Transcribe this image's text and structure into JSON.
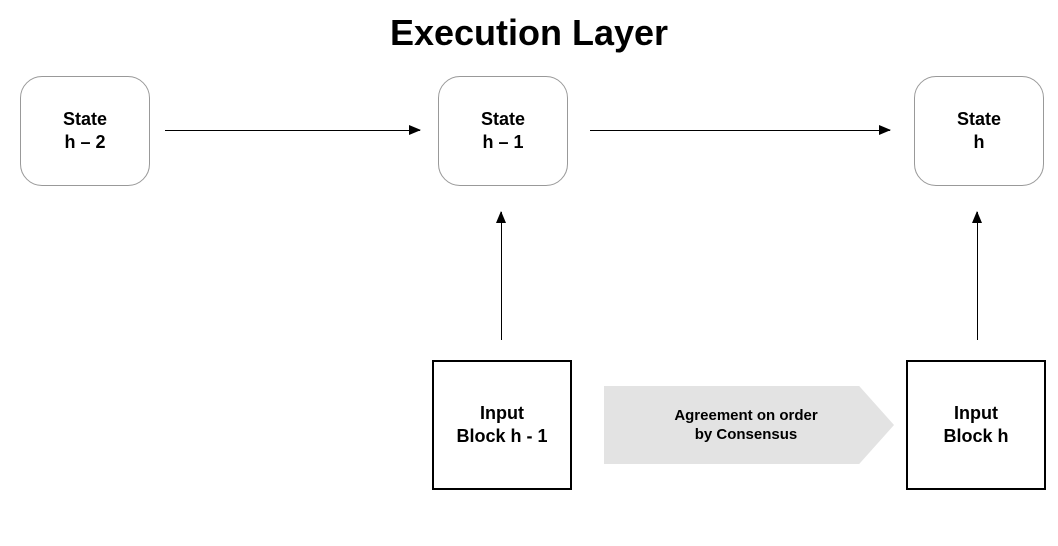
{
  "title": "Execution Layer",
  "states": {
    "h_minus_2": {
      "label": "State",
      "sub": "h – 2"
    },
    "h_minus_1": {
      "label": "State",
      "sub": "h – 1"
    },
    "h": {
      "label": "State",
      "sub": "h"
    }
  },
  "inputs": {
    "h_minus_1": {
      "line1": "Input",
      "line2": "Block h - 1"
    },
    "h": {
      "line1": "Input",
      "line2": "Block h"
    }
  },
  "agreement": {
    "line1": "Agreement on order",
    "line2": "by Consensus"
  }
}
